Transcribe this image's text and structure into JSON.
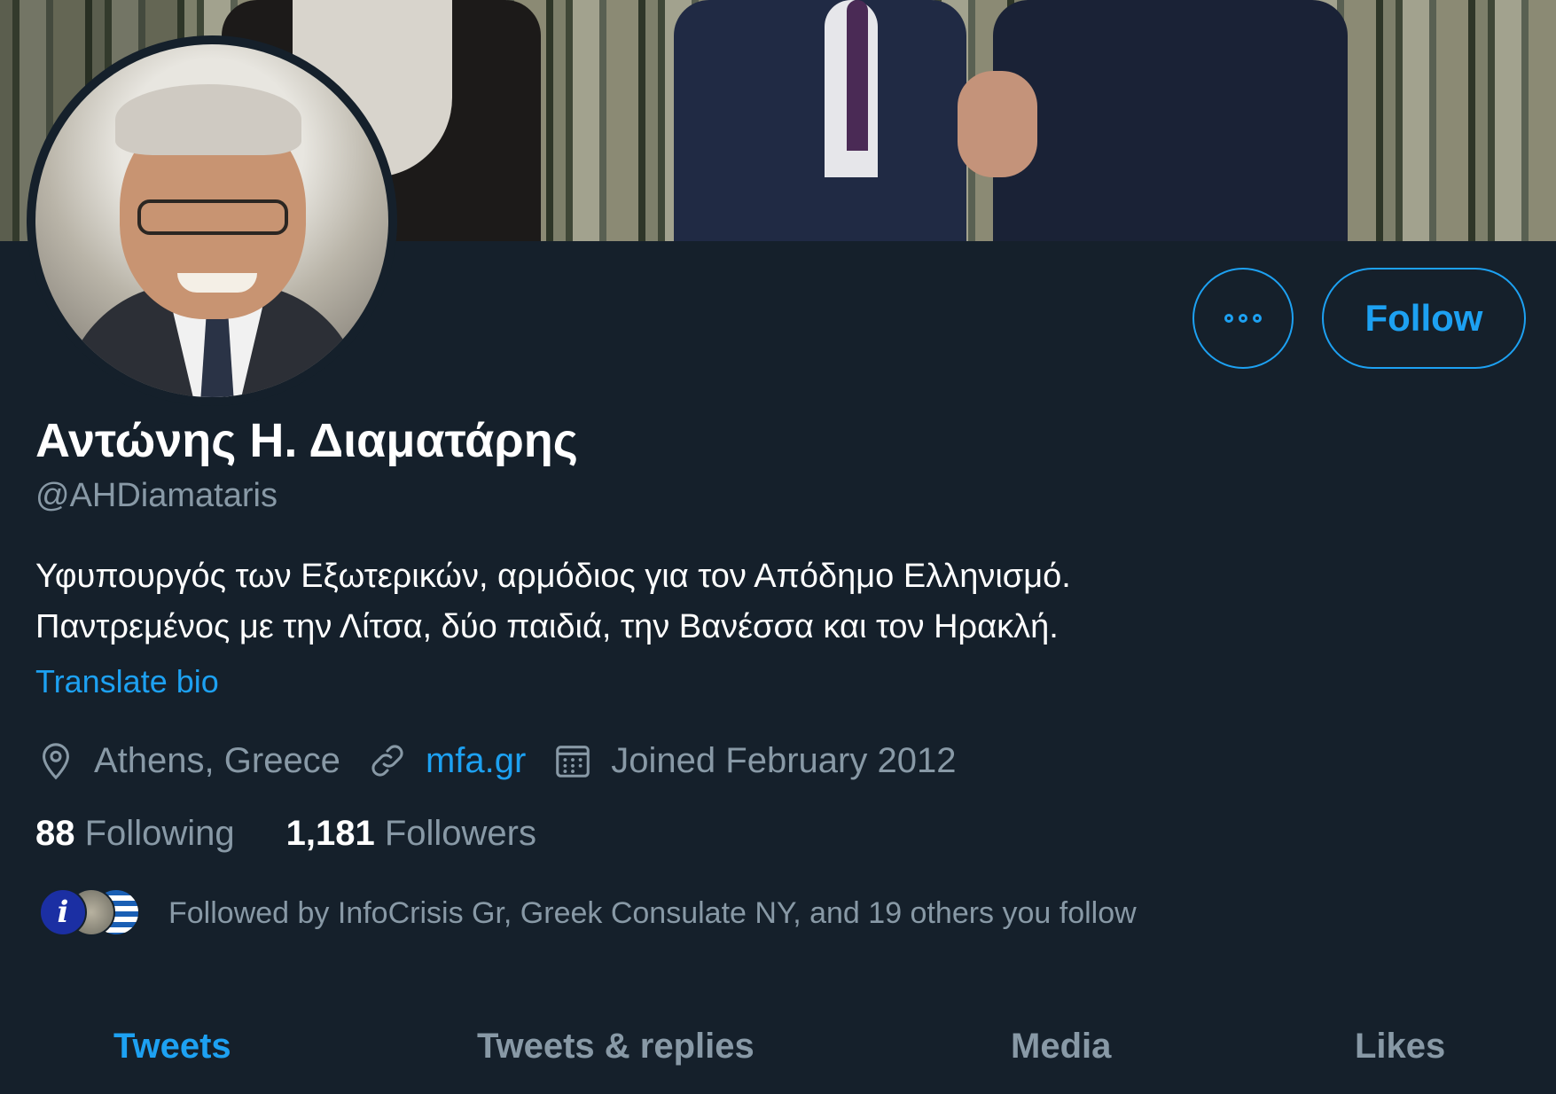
{
  "profile": {
    "name": "Αντώνης Η. Διαματάρης",
    "handle": "@AHDiamataris",
    "bio_line_1": "Υφυπουργός των Εξωτερικών, αρμόδιος για τον Απόδημο Ελληνισμό.",
    "bio_line_2": "Παντρεμένος με την Λίτσα, δύο παιδιά, την Βανέσσα και τον Ηρακλή.",
    "translate_label": "Translate bio",
    "location": "Athens, Greece",
    "website": "mfa.gr",
    "joined": "Joined February 2012"
  },
  "actions": {
    "follow_label": "Follow"
  },
  "stats": {
    "following_count": "88",
    "following_label": "Following",
    "followers_count": "1,181",
    "followers_label": "Followers"
  },
  "followed_by": {
    "text": "Followed by InfoCrisis Gr, Greek Consulate NY, and 19 others you follow",
    "first_avatar_glyph": "i"
  },
  "tabs": [
    {
      "label": "Tweets",
      "active": true
    },
    {
      "label": "Tweets & replies",
      "active": false
    },
    {
      "label": "Media",
      "active": false
    },
    {
      "label": "Likes",
      "active": false
    }
  ],
  "icons": {
    "location": "location-pin-icon",
    "link": "link-icon",
    "calendar": "calendar-icon",
    "more": "more-icon"
  },
  "colors": {
    "background": "#15202b",
    "accent": "#1da1f2",
    "secondary_text": "#8899a6",
    "primary_text": "#ffffff"
  }
}
